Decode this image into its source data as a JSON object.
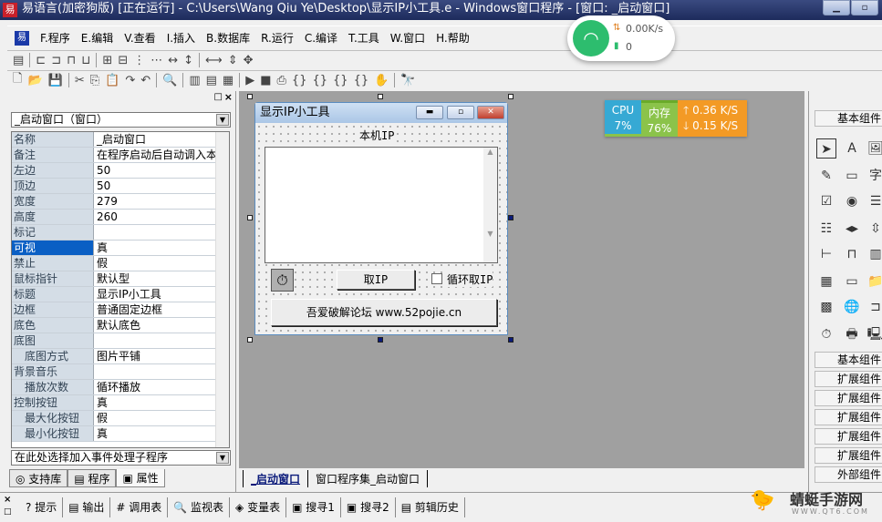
{
  "title": "易语言(加密狗版) [正在运行] - C:\\Users\\Wang Qiu Ye\\Desktop\\显示IP小工具.e - Windows窗口程序 - [窗口: _启动窗口]",
  "menu": [
    "F.程序",
    "E.编辑",
    "V.查看",
    "I.插入",
    "B.数据库",
    "R.运行",
    "C.编译",
    "T.工具",
    "W.窗口",
    "H.帮助"
  ],
  "left_panel": {
    "object_select": "_启动窗口（窗口）",
    "properties": [
      {
        "k": "名称",
        "v": "_启动窗口"
      },
      {
        "k": "备注",
        "v": "在程序启动后自动调入本"
      },
      {
        "k": "左边",
        "v": "50"
      },
      {
        "k": "顶边",
        "v": "50"
      },
      {
        "k": "宽度",
        "v": "279"
      },
      {
        "k": "高度",
        "v": "260"
      },
      {
        "k": "标记",
        "v": ""
      },
      {
        "k": "可视",
        "v": "真"
      },
      {
        "k": "禁止",
        "v": "假"
      },
      {
        "k": "鼠标指针",
        "v": "默认型"
      },
      {
        "k": "标题",
        "v": "显示IP小工具"
      },
      {
        "k": "边框",
        "v": "普通固定边框"
      },
      {
        "k": "底色",
        "v": "默认底色"
      },
      {
        "k": "底图",
        "v": ""
      },
      {
        "k": "底图方式",
        "v": "图片平铺"
      },
      {
        "k": "背景音乐",
        "v": ""
      },
      {
        "k": "播放次数",
        "v": "循环播放"
      },
      {
        "k": "控制按钮",
        "v": "真"
      },
      {
        "k": "最大化按钮",
        "v": "假"
      },
      {
        "k": "最小化按钮",
        "v": "真"
      }
    ],
    "event_select": "在此处选择加入事件处理子程序",
    "tabs": [
      "支持库",
      "程序",
      "属性"
    ]
  },
  "form": {
    "title": "显示IP小工具",
    "label": "本机IP",
    "get_ip_button": "取IP",
    "loop_checkbox": "循环取IP",
    "loop_checked": false,
    "link_button": "吾爱破解论坛 www.52pojie.cn"
  },
  "design_tabs": [
    "_启动窗口",
    "窗口程序集_启动窗口"
  ],
  "right_panel": {
    "top_group": "基本组件",
    "groups": [
      "基本组件",
      "扩展组件",
      "扩展组件",
      "扩展组件",
      "扩展组件",
      "扩展组件",
      "外部组件"
    ]
  },
  "bottom_tabs": [
    "提示",
    "输出",
    "调用表",
    "监视表",
    "变量表",
    "搜寻1",
    "搜寻2",
    "剪辑历史"
  ],
  "wifi_widget": {
    "speed": "0.00K/s",
    "count": "0",
    "color": "#2dbd6e"
  },
  "cpu_widget": {
    "cpu_label": "CPU",
    "cpu": "7%",
    "mem_label": "内存",
    "mem": "76%",
    "up": "0.36 K/S",
    "down": "0.15 K/S"
  },
  "watermark": {
    "name": "蜻蜓手游网",
    "url": "WWW.QT6.COM"
  }
}
